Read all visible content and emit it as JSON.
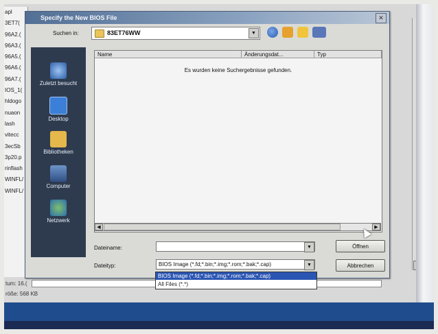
{
  "dialog": {
    "title": "Specify the New BIOS File",
    "look_in_label": "Suchen in:",
    "look_in_value": "83ET76WW",
    "column_headers": [
      "Name",
      "Änderungsdat...",
      "Typ"
    ],
    "no_results_text": "Es wurden keine Suchergebnisse gefunden.",
    "places": [
      "Zuletzt besucht",
      "Desktop",
      "Bibliotheken",
      "Computer",
      "Netzwerk"
    ],
    "filename_label": "Dateiname:",
    "filename_value": "",
    "filetype_label": "Dateityp:",
    "filetype_value": "BIOS Image (*.fd;*.bin;*.img;*.rom;*.bak;*.cap)",
    "open_button": "Öffnen",
    "cancel_button": "Abbrechen",
    "filetype_options": [
      "BIOS Image (*.fd;*.bin;*.img;*.rom;*.bak;*.cap)",
      "All Files (*.*)"
    ]
  },
  "background": {
    "list_items": [
      "apl",
      "3ET7(",
      "96A2.(",
      "96A3.(",
      "96A5.(",
      "96A6.(",
      "96A7.(",
      "IOS_1(",
      "hldogo",
      "nuaon",
      "lash",
      "vitecc",
      "3ecSb",
      "3p20.p",
      "rinflash",
      "WINFL/",
      "WINFL/"
    ],
    "status_lines": [
      "tum: 16.(",
      "röße: 568 KB"
    ]
  },
  "colors": {
    "titlebar": "#526f95",
    "places_bar": "#2e3b4f",
    "selection": "#2b55b3"
  }
}
